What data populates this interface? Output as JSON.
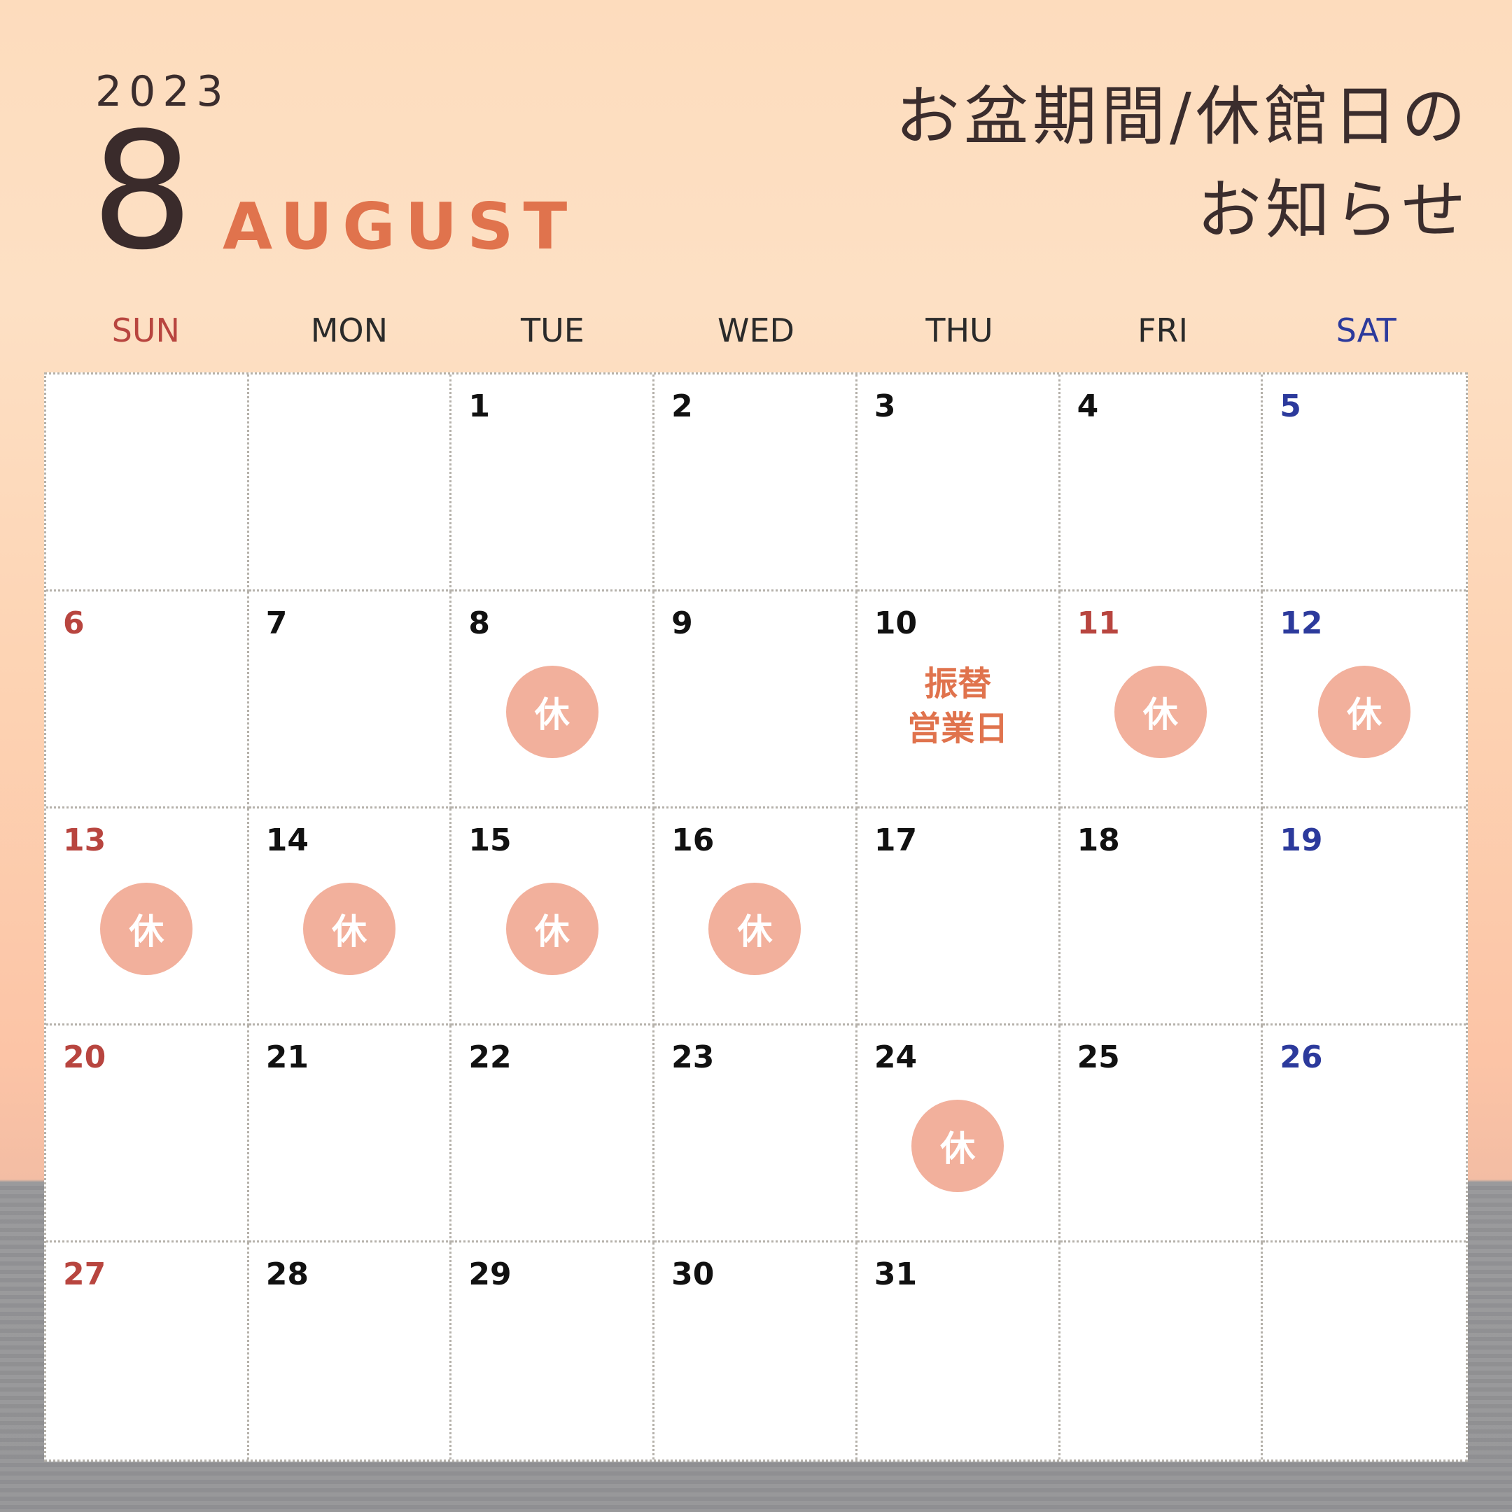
{
  "header": {
    "year": "2023",
    "month_number": "8",
    "month_name": "AUGUST",
    "notice_line1": "お盆期間/休館日の",
    "notice_line2": "お知らせ"
  },
  "colors": {
    "accent": "#e0734d",
    "closed_circle": "#f2b09c",
    "sunday": "#b8453f",
    "saturday": "#2c3a9c",
    "text": "#3b2d2d"
  },
  "weekdays": [
    "SUN",
    "MON",
    "TUE",
    "WED",
    "THU",
    "FRI",
    "SAT"
  ],
  "closed_label": "休",
  "workday_label_line1": "振替",
  "workday_label_line2": "営業日",
  "weeks": [
    [
      {
        "d": ""
      },
      {
        "d": ""
      },
      {
        "d": "1"
      },
      {
        "d": "2"
      },
      {
        "d": "3"
      },
      {
        "d": "4"
      },
      {
        "d": "5"
      }
    ],
    [
      {
        "d": "6"
      },
      {
        "d": "7"
      },
      {
        "d": "8",
        "closed": true
      },
      {
        "d": "9"
      },
      {
        "d": "10",
        "workday": true
      },
      {
        "d": "11",
        "closed": true,
        "holiday": true
      },
      {
        "d": "12",
        "closed": true
      }
    ],
    [
      {
        "d": "13",
        "closed": true
      },
      {
        "d": "14",
        "closed": true
      },
      {
        "d": "15",
        "closed": true
      },
      {
        "d": "16",
        "closed": true
      },
      {
        "d": "17"
      },
      {
        "d": "18"
      },
      {
        "d": "19"
      }
    ],
    [
      {
        "d": "20"
      },
      {
        "d": "21"
      },
      {
        "d": "22"
      },
      {
        "d": "23"
      },
      {
        "d": "24",
        "closed": true
      },
      {
        "d": "25"
      },
      {
        "d": "26"
      }
    ],
    [
      {
        "d": "27"
      },
      {
        "d": "28"
      },
      {
        "d": "29"
      },
      {
        "d": "30"
      },
      {
        "d": "31"
      },
      {
        "d": ""
      },
      {
        "d": ""
      }
    ]
  ]
}
